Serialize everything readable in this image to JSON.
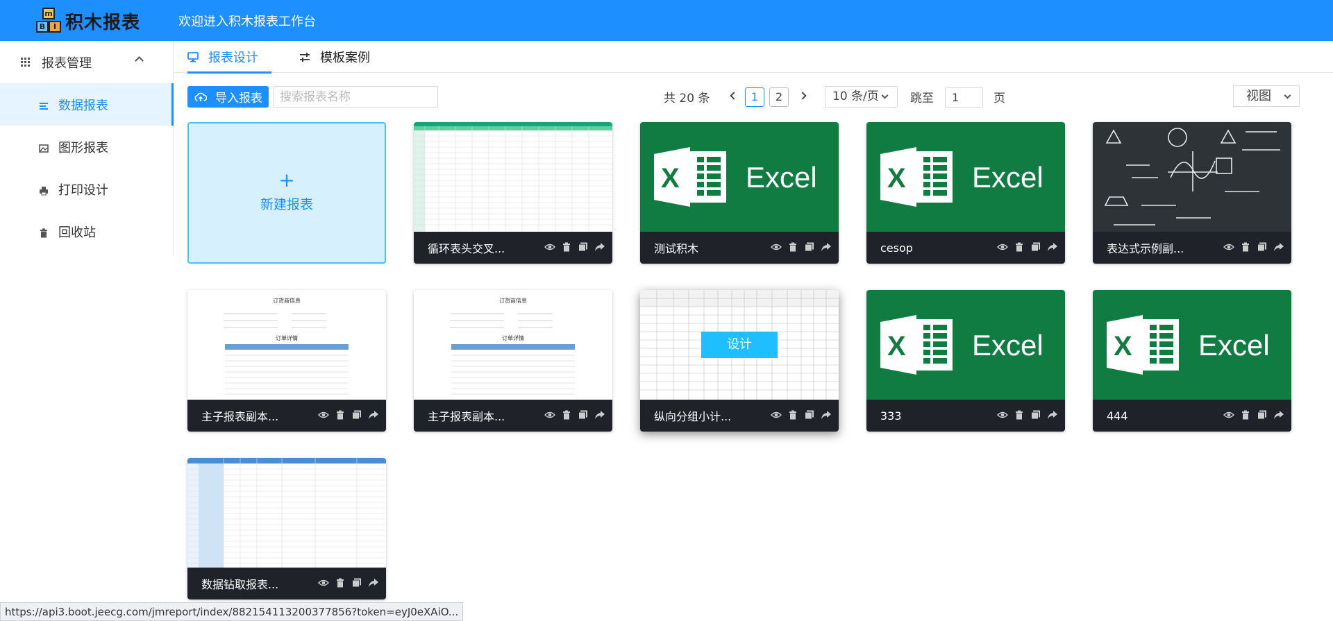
{
  "header": {
    "logo_text": "积木报表",
    "welcome": "欢迎进入积木报表工作台"
  },
  "sidebar": {
    "group_label": "报表管理",
    "items": [
      {
        "label": "数据报表",
        "icon": "list-icon",
        "active": true
      },
      {
        "label": "图形报表",
        "icon": "image-icon"
      },
      {
        "label": "打印设计",
        "icon": "printer-icon"
      },
      {
        "label": "回收站",
        "icon": "trash-icon"
      }
    ]
  },
  "tabs": [
    {
      "label": "报表设计",
      "icon": "monitor-icon",
      "active": true
    },
    {
      "label": "模板案例",
      "icon": "sliders-icon"
    }
  ],
  "toolbar": {
    "import_label": "导入报表",
    "search_placeholder": "搜索报表名称",
    "total": "共 20 条",
    "pages": [
      "1",
      "2"
    ],
    "current_page": "1",
    "per_page": "10 条/页",
    "jump_label": "跳至",
    "jump_value": "1",
    "page_label": "页",
    "view_label": "视图"
  },
  "new_report_label": "新建报表",
  "design_button": "设计",
  "cards": [
    {
      "name": "循环表头交叉...",
      "thumb": "table"
    },
    {
      "name": "测试积木",
      "thumb": "excel"
    },
    {
      "name": "cesop",
      "thumb": "excel"
    },
    {
      "name": "表达式示例副...",
      "thumb": "chalkboard"
    },
    {
      "name": "主子报表副本...",
      "thumb": "order"
    },
    {
      "name": "主子报表副本...",
      "thumb": "order"
    },
    {
      "name": "纵向分组小计...",
      "thumb": "group"
    },
    {
      "name": "333",
      "thumb": "excel"
    },
    {
      "name": "444",
      "thumb": "excel"
    },
    {
      "name": "数据钻取报表...",
      "thumb": "drill"
    }
  ],
  "excel_word": "Excel",
  "order_thumb": {
    "title": "订货商信息",
    "subtitle": "订单详情"
  },
  "status_url": "https://api3.boot.jeecg.com/jmreport/index/882154113200377856?token=eyJ0eXAiO...",
  "colors": {
    "primary": "#1e8fff",
    "excel_green": "#107c41",
    "card_footer": "#1f2329"
  }
}
